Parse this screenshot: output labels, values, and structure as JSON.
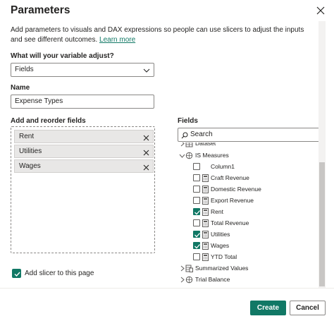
{
  "dialog": {
    "title": "Parameters",
    "description": "Add parameters to visuals and DAX expressions so people can use slicers to adjust the inputs and see different outcomes.",
    "learn_more": "Learn more"
  },
  "variable_section": {
    "label": "What will your variable adjust?",
    "selected": "Fields"
  },
  "name_section": {
    "label": "Name",
    "value": "Expense Types"
  },
  "reorder_section": {
    "label": "Add and reorder fields",
    "items": [
      {
        "label": "Rent"
      },
      {
        "label": "Utilities"
      },
      {
        "label": "Wages"
      }
    ]
  },
  "slicer_option": {
    "label": "Add slicer to this page",
    "checked": true
  },
  "fields_panel": {
    "label": "Fields",
    "search_placeholder": "Search",
    "partial_top": "Dataset",
    "tree": [
      {
        "label": "IS Measures",
        "kind": "table",
        "expanded": true,
        "level": 0
      },
      {
        "label": "Column1",
        "kind": "column",
        "checked": false,
        "level": 1
      },
      {
        "label": "Craft Revenue",
        "kind": "measure",
        "checked": false,
        "level": 1
      },
      {
        "label": "Domestic Revenue",
        "kind": "measure",
        "checked": false,
        "level": 1
      },
      {
        "label": "Export Revenue",
        "kind": "measure",
        "checked": false,
        "level": 1
      },
      {
        "label": "Rent",
        "kind": "measure",
        "checked": true,
        "level": 1
      },
      {
        "label": "Total Revenue",
        "kind": "measure",
        "checked": false,
        "level": 1
      },
      {
        "label": "Utilities",
        "kind": "measure",
        "checked": true,
        "level": 1
      },
      {
        "label": "Wages",
        "kind": "measure",
        "checked": true,
        "level": 1
      },
      {
        "label": "YTD Total",
        "kind": "measure",
        "checked": false,
        "level": 1
      },
      {
        "label": "Summarized Values",
        "kind": "table",
        "expanded": false,
        "level": 0
      },
      {
        "label": "Trial Balance",
        "kind": "table",
        "expanded": false,
        "level": 0
      }
    ]
  },
  "buttons": {
    "create": "Create",
    "cancel": "Cancel"
  },
  "colors": {
    "accent": "#117865",
    "border": "#8a8886",
    "pill_bg": "#e8e7e6"
  }
}
